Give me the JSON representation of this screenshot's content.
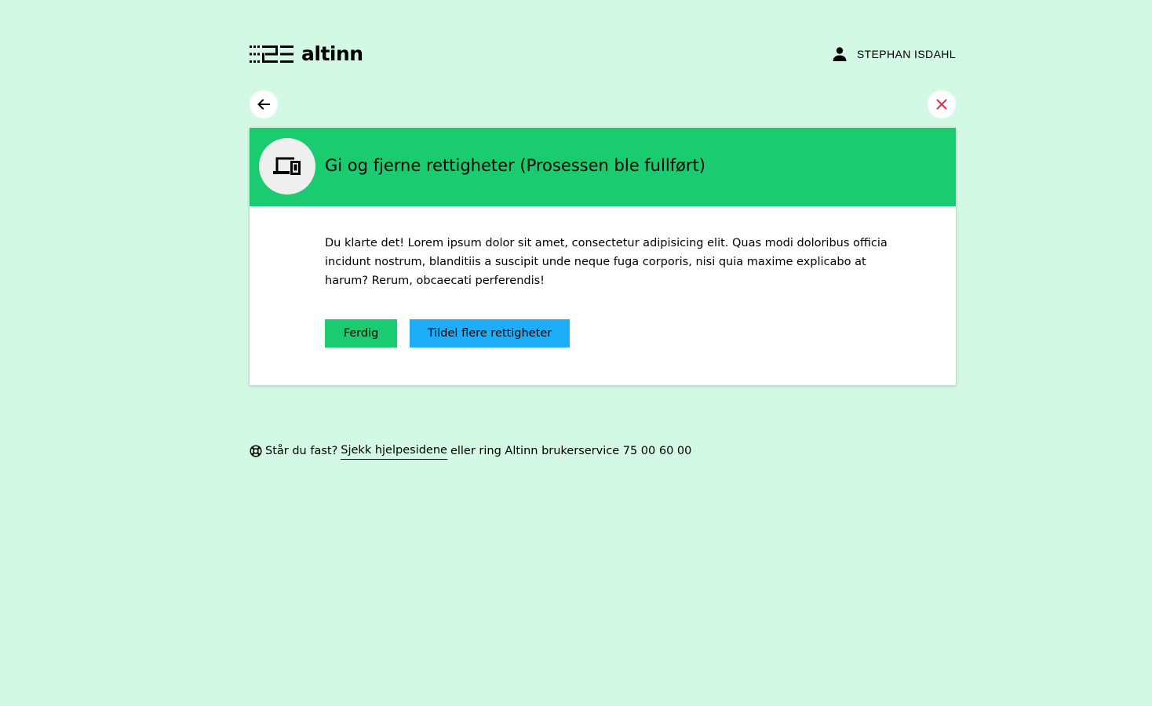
{
  "header": {
    "logo_text": "altinn",
    "user_name": "STEPHAN ISDAHL"
  },
  "nav": {
    "back_icon": "arrow-left-icon",
    "close_icon": "close-icon",
    "close_color": "#e02e49"
  },
  "card": {
    "icon": "devices-icon",
    "title": "Gi og fjerne rettigheter (Prosessen ble fullført)",
    "text": "Du klarte det! Lorem ipsum dolor sit amet, consectetur adipisicing elit. Quas modi doloribus officia incidunt nostrum, blanditiis a suscipit unde neque fuga corporis, nisi quia maxime explicabo at harum? Rerum, obcaecati perferendis!",
    "header_color": "#1bcb70",
    "buttons": {
      "done_label": "Ferdig",
      "more_label": "Tildel flere rettigheter"
    }
  },
  "help": {
    "icon": "lifebuoy-icon",
    "prefix": "Står du fast?",
    "link_label": "Sjekk hjelpesidene",
    "suffix": "eller ring Altinn brukerservice 75 00 60 00"
  },
  "colors": {
    "background": "#d3f9e5",
    "primary_green": "#1bcb70",
    "secondary_blue": "#1eadf7"
  }
}
